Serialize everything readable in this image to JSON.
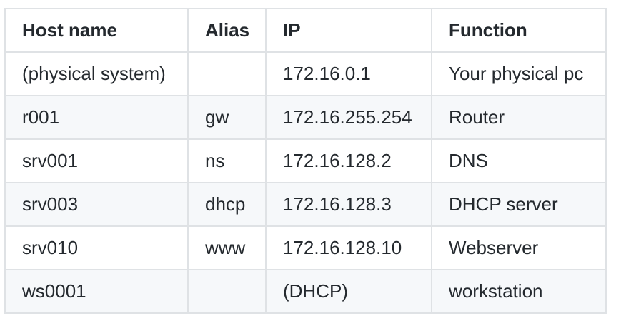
{
  "table": {
    "headers": [
      "Host name",
      "Alias",
      "IP",
      "Function"
    ],
    "rows": [
      [
        "(physical system)",
        "",
        "172.16.0.1",
        "Your physical pc"
      ],
      [
        "r001",
        "gw",
        "172.16.255.254",
        "Router"
      ],
      [
        "srv001",
        "ns",
        "172.16.128.2",
        "DNS"
      ],
      [
        "srv003",
        "dhcp",
        "172.16.128.3",
        "DHCP server"
      ],
      [
        "srv010",
        "www",
        "172.16.128.10",
        "Webserver"
      ],
      [
        "ws0001",
        "",
        "(DHCP)",
        "workstation"
      ]
    ]
  }
}
